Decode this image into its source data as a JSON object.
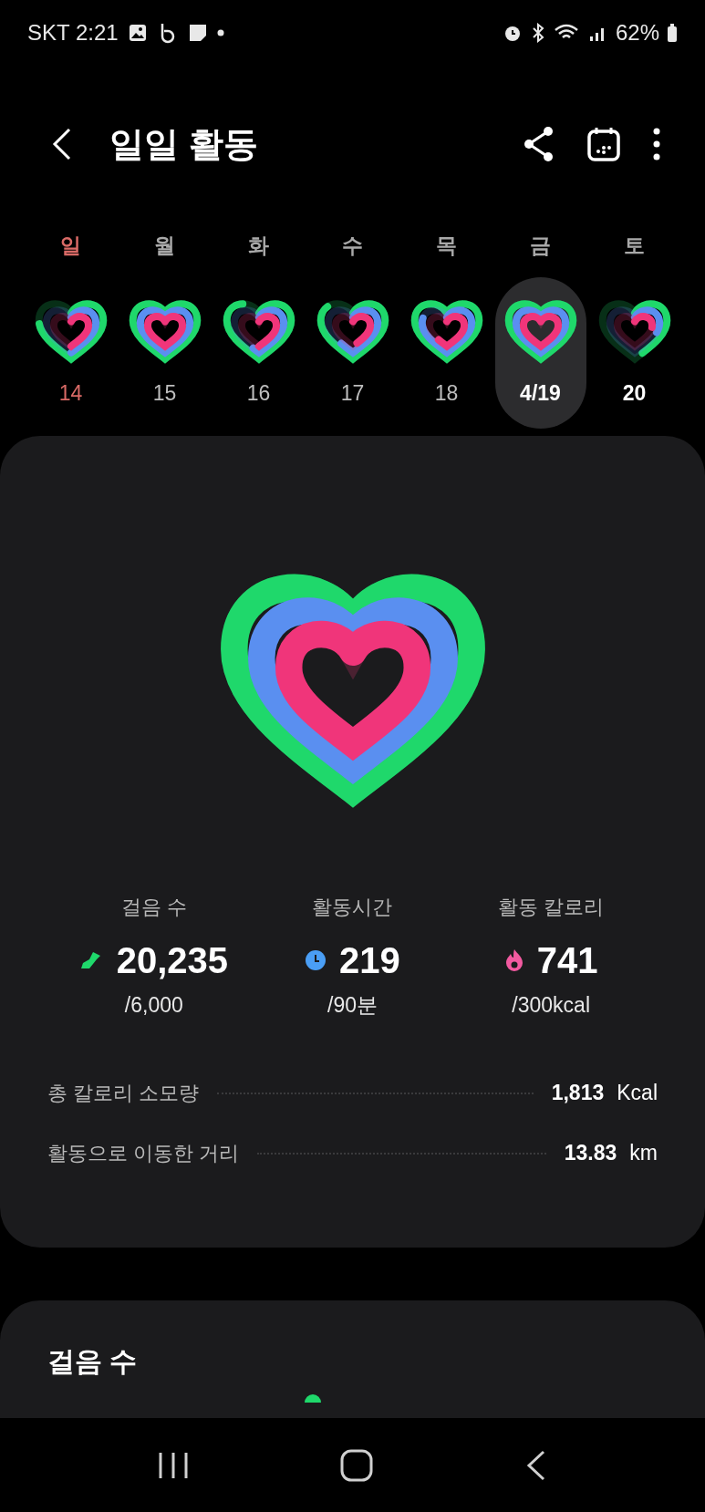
{
  "status_bar": {
    "carrier_time": "SKT 2:21",
    "battery": "62%"
  },
  "header": {
    "title": "일일 활동"
  },
  "days": [
    {
      "weekday": "일",
      "date": "14",
      "kind": "sunday",
      "selected": false,
      "emphasized": false
    },
    {
      "weekday": "월",
      "date": "15",
      "kind": "weekday",
      "selected": false,
      "emphasized": false
    },
    {
      "weekday": "화",
      "date": "16",
      "kind": "weekday",
      "selected": false,
      "emphasized": false
    },
    {
      "weekday": "수",
      "date": "17",
      "kind": "weekday",
      "selected": false,
      "emphasized": false
    },
    {
      "weekday": "목",
      "date": "18",
      "kind": "weekday",
      "selected": false,
      "emphasized": false
    },
    {
      "weekday": "금",
      "date": "4/19",
      "kind": "weekday",
      "selected": true,
      "emphasized": true
    },
    {
      "weekday": "토",
      "date": "20",
      "kind": "weekday",
      "selected": false,
      "emphasized": true
    }
  ],
  "summary": {
    "stats": [
      {
        "kind": "steps",
        "label": "걸음 수",
        "value": "20,235",
        "goal": "/6,000"
      },
      {
        "kind": "time",
        "label": "활동시간",
        "value": "219",
        "goal": "/90분"
      },
      {
        "kind": "calories",
        "label": "활동 칼로리",
        "value": "741",
        "goal": "/300kcal"
      }
    ],
    "details": [
      {
        "label": "총 칼로리 소모량",
        "value": "1,813",
        "unit": "Kcal"
      },
      {
        "label": "활동으로 이동한 거리",
        "value": "13.83",
        "unit": "km"
      }
    ]
  },
  "steps_card": {
    "title": "걸음 수"
  }
}
